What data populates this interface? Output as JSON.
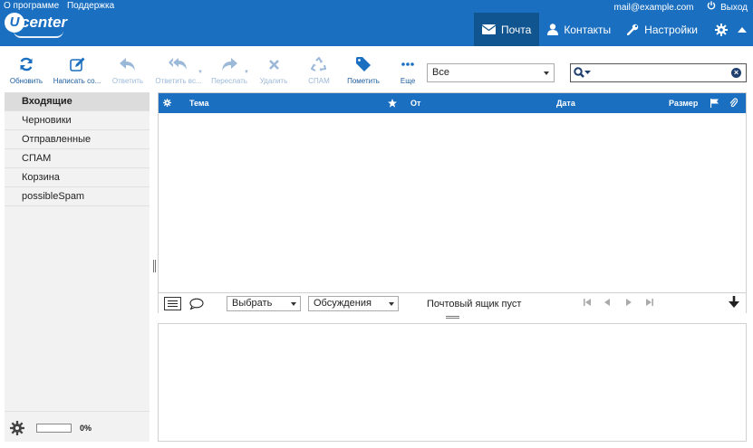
{
  "top_links": {
    "about": "О программе",
    "support": "Поддержка"
  },
  "user": {
    "email": "mail@example.com",
    "logout": "Выход"
  },
  "logo": {
    "text": "center",
    "letter": "U"
  },
  "nav": {
    "mail": "Почта",
    "contacts": "Контакты",
    "settings": "Настройки"
  },
  "toolbar": {
    "refresh": "Обновить",
    "compose": "Написать со...",
    "reply": "Ответить",
    "reply_all": "Ответить вс...",
    "forward": "Переслать",
    "delete": "Удалить",
    "spam": "СПАМ",
    "mark": "Пометить",
    "more": "Еще"
  },
  "filter": {
    "value": "Все"
  },
  "search": {
    "value": ""
  },
  "folders": [
    "Входящие",
    "Черновики",
    "Отправленные",
    "СПАМ",
    "Корзина",
    "possibleSpam"
  ],
  "quota": {
    "percent_text": "0%",
    "percent": 0
  },
  "columns": {
    "subject": "Тема",
    "from": "От",
    "date": "Дата",
    "size": "Размер"
  },
  "list_footer": {
    "select": "Выбрать",
    "threads": "Обсуждения",
    "status": "Почтовый ящик пуст"
  },
  "colors": {
    "brand": "#1a6fc1",
    "active_nav": "#115590"
  }
}
